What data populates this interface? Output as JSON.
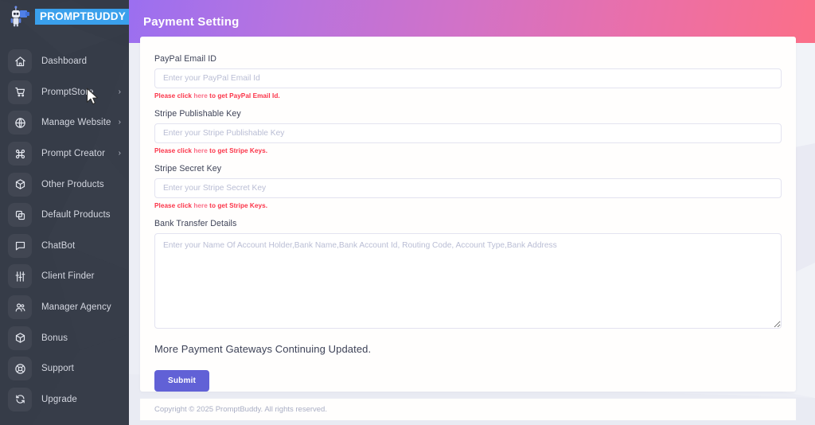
{
  "sidebar": {
    "logo": {
      "icon": "robot-icon",
      "text": "PROMPTBUDDY"
    },
    "items": [
      {
        "label": "Dashboard",
        "icon": "home-icon",
        "caret": ""
      },
      {
        "label": "PromptStore",
        "icon": "cart-icon",
        "caret": "›"
      },
      {
        "label": "Manage Website",
        "icon": "globe-icon",
        "caret": "›"
      },
      {
        "label": "Prompt Creator",
        "icon": "command-icon",
        "caret": "›"
      },
      {
        "label": "Other Products",
        "icon": "box-icon",
        "caret": ""
      },
      {
        "label": "Default Products",
        "icon": "copy-icon",
        "caret": ""
      },
      {
        "label": "ChatBot",
        "icon": "chat-icon",
        "caret": ""
      },
      {
        "label": "Client Finder",
        "icon": "sliders-icon",
        "caret": ""
      },
      {
        "label": "Manager Agency",
        "icon": "users-icon",
        "caret": ""
      },
      {
        "label": "Bonus",
        "icon": "cube-icon",
        "caret": ""
      },
      {
        "label": "Support",
        "icon": "lifebuoy-icon",
        "caret": ""
      },
      {
        "label": "Upgrade",
        "icon": "refresh-icon",
        "caret": ""
      }
    ]
  },
  "topbar": {
    "title": "Payment Setting",
    "gradient_from": "#9b6ff0",
    "gradient_to": "#fb6f88"
  },
  "form": {
    "paypal": {
      "label": "PayPal Email ID",
      "placeholder": "Enter your PayPal Email Id",
      "value": "",
      "hint_before": "Please click ",
      "hint_link": "here",
      "hint_after": " to get PayPal Email Id."
    },
    "stripe_publishable": {
      "label": "Stripe Publishable Key",
      "placeholder": "Enter your Stripe Publishable Key",
      "value": "",
      "hint_before": "Please click ",
      "hint_link": "here",
      "hint_after": " to get Stripe Keys."
    },
    "stripe_secret": {
      "label": "Stripe Secret Key",
      "placeholder": "Enter your Stripe Secret Key",
      "value": "",
      "hint_before": "Please click ",
      "hint_link": "here",
      "hint_after": " to get Stripe Keys."
    },
    "bank": {
      "label": "Bank Transfer Details",
      "placeholder": "Enter your Name Of Account Holder,Bank Name,Bank Account Id, Routing Code, Account Type,Bank Address",
      "value": ""
    },
    "note": "More Payment Gateways Continuing Updated.",
    "submit_label": "Submit",
    "submit_color": "#6161d6"
  },
  "footer": {
    "text": "Copyright © 2025 PromptBuddy. All rights reserved."
  }
}
